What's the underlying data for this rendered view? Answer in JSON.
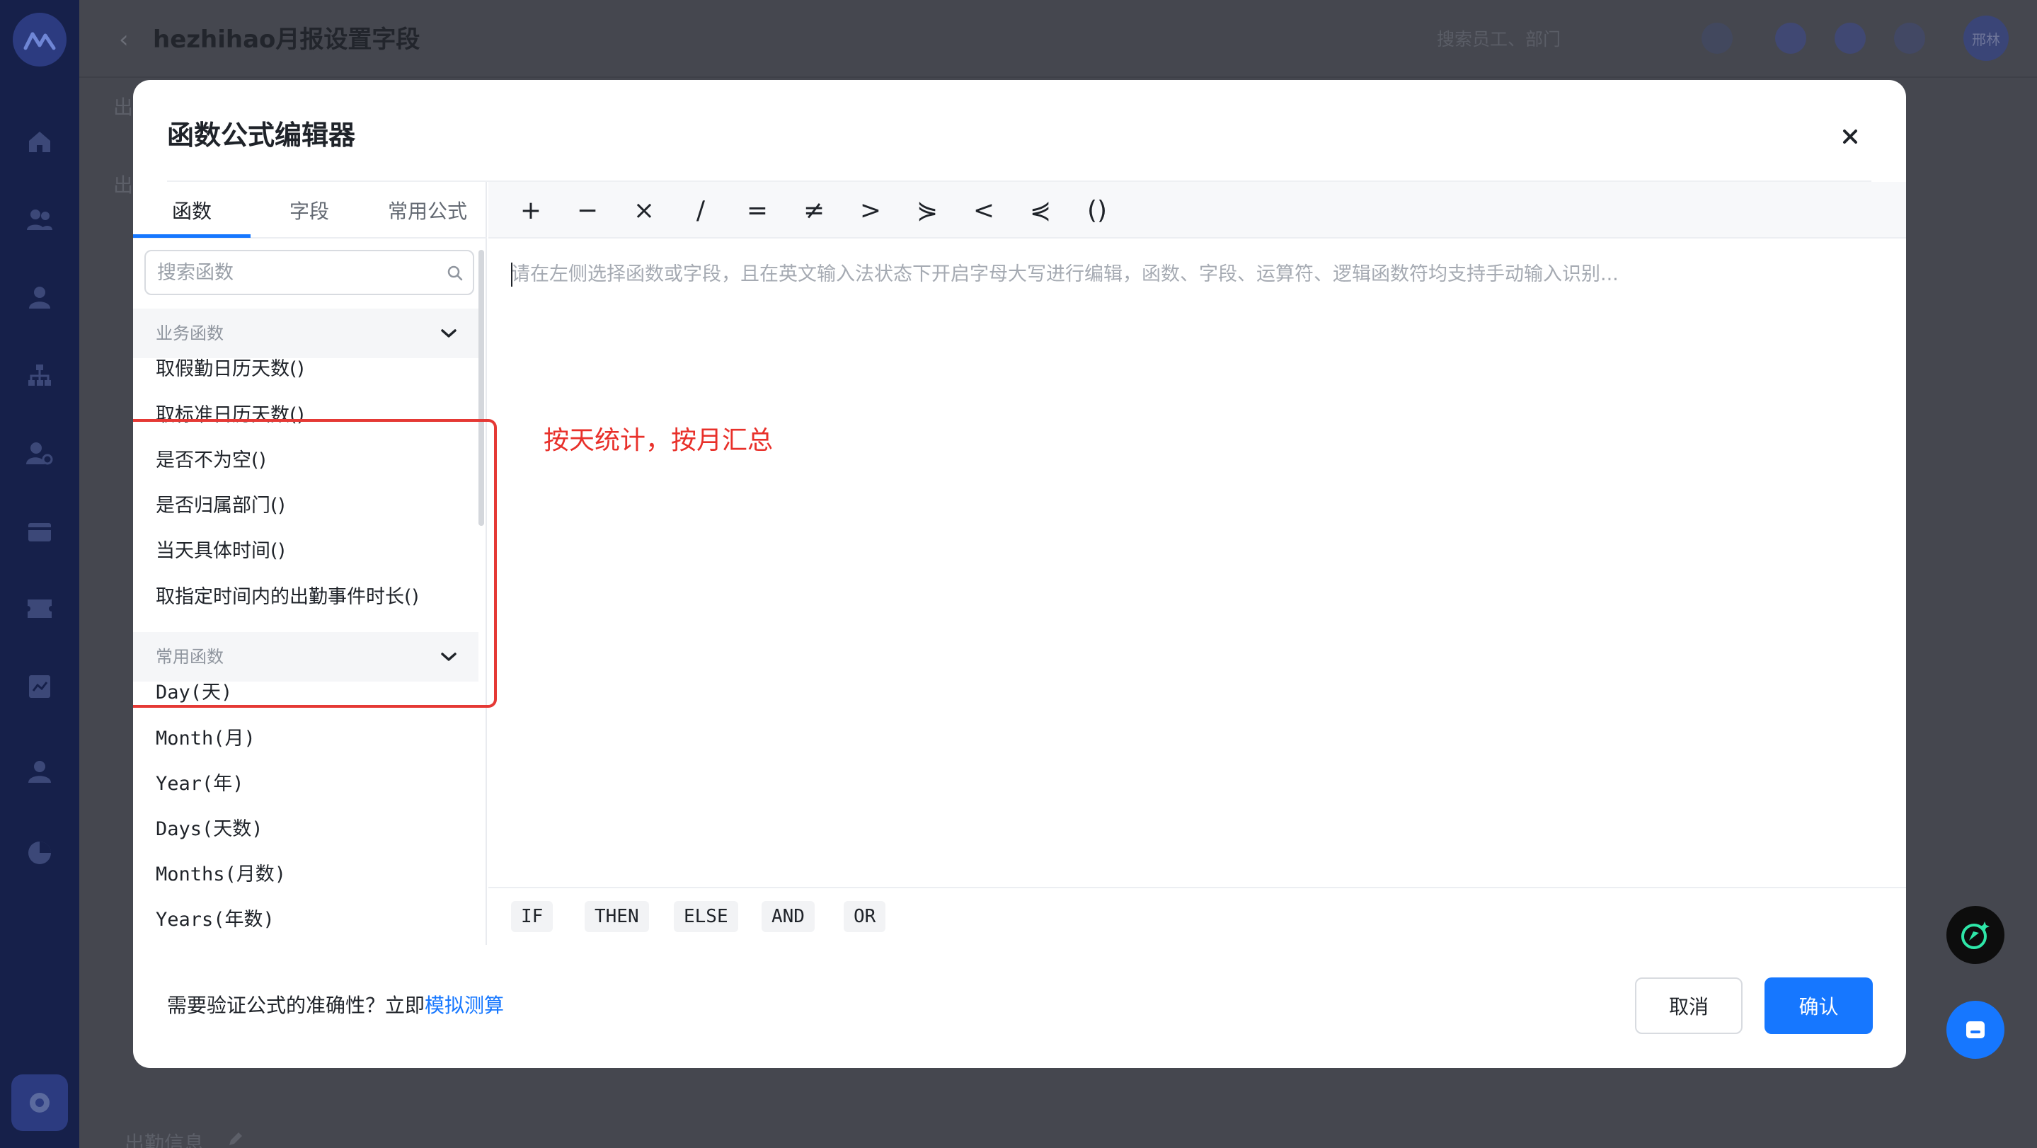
{
  "background": {
    "page_title": "hezhihao月报设置字段",
    "search_placeholder": "搜索员工、部门",
    "avatar_text": "邢林",
    "bg_label_1": "出",
    "bg_label_2": "出",
    "bg_bottom_label": "出勤信息"
  },
  "modal": {
    "title": "函数公式编辑器",
    "tabs": [
      {
        "label": "函数"
      },
      {
        "label": "字段"
      },
      {
        "label": "常用公式"
      }
    ],
    "search_placeholder": "搜索函数",
    "groups": [
      {
        "title": "业务函数",
        "items": [
          "取假勤日历天数()",
          "取标准日历天数()",
          "是否不为空()",
          "是否归属部门()",
          "当天具体时间()",
          "取指定时间内的出勤事件时长()"
        ]
      },
      {
        "title": "常用函数",
        "items": [
          "Day(天)",
          "Month(月)",
          "Year(年)",
          "Days(天数)",
          "Months(月数)",
          "Years(年数)"
        ]
      }
    ],
    "operators": [
      "+",
      "−",
      "×",
      "/",
      "=",
      "≠",
      ">",
      "⋟",
      "<",
      "⋞",
      "()"
    ],
    "editor_placeholder": "请在左侧选择函数或字段，且在英文输入法状态下开启字母大写进行编辑，函数、字段、运算符、逻辑函数符均支持手动输入识别...",
    "annotation": "按天统计，按月汇总",
    "keywords": [
      "IF",
      "THEN",
      "ELSE",
      "AND",
      "OR"
    ],
    "footer_text": "需要验证公式的准确性？立即",
    "footer_link": "模拟测算",
    "cancel_label": "取消",
    "confirm_label": "确认"
  },
  "colors": {
    "primary": "#1677ff",
    "annotation_red": "#e53935",
    "sidebar_bg": "#16204a"
  }
}
